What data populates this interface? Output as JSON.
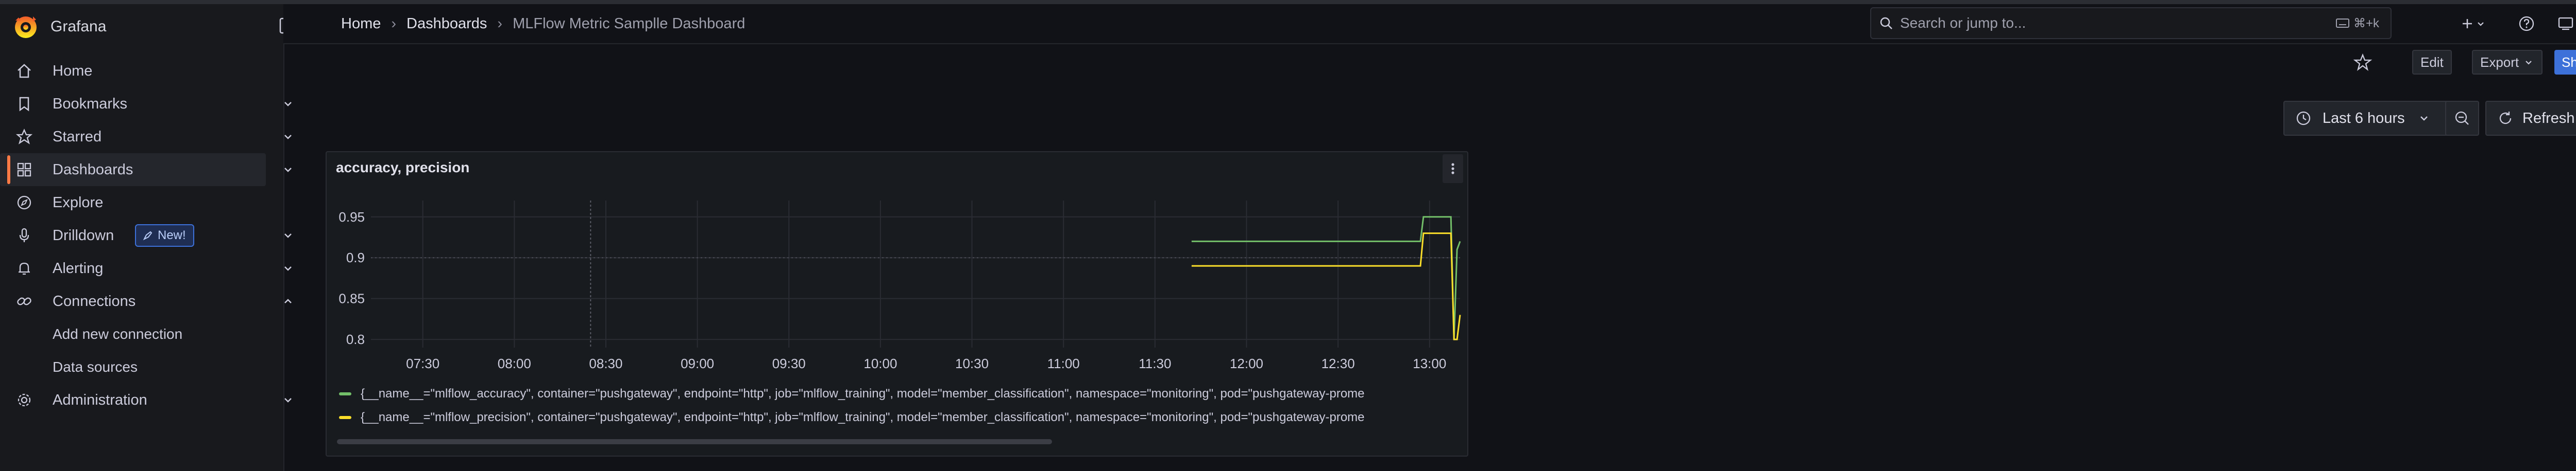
{
  "app": {
    "name": "Grafana"
  },
  "colors": {
    "accent": "#ff7a45",
    "primary": "#3d71d9",
    "series_accuracy": "#73bf69",
    "series_precision": "#fade2a"
  },
  "sidebar": {
    "items": [
      {
        "label": "Home",
        "icon": "home-icon",
        "chevron": ""
      },
      {
        "label": "Bookmarks",
        "icon": "bookmark-icon",
        "chevron": "down"
      },
      {
        "label": "Starred",
        "icon": "star-icon",
        "chevron": "down"
      },
      {
        "label": "Dashboards",
        "icon": "apps-icon",
        "chevron": "down",
        "active": true
      },
      {
        "label": "Explore",
        "icon": "compass-icon",
        "chevron": ""
      },
      {
        "label": "Drilldown",
        "icon": "microphone-icon",
        "chevron": "down",
        "badge": "New!"
      },
      {
        "label": "Alerting",
        "icon": "bell-icon",
        "chevron": "down"
      },
      {
        "label": "Connections",
        "icon": "link-icon",
        "chevron": "up"
      },
      {
        "label": "Administration",
        "icon": "cog-icon",
        "chevron": "down"
      }
    ],
    "connections_sub": [
      "Add new connection",
      "Data sources"
    ]
  },
  "header": {
    "breadcrumbs": [
      "Home",
      "Dashboards",
      "MLFlow Metric Samplle Dashboard"
    ],
    "search_placeholder": "Search or jump to...",
    "search_shortcut": "⌘+k"
  },
  "toolbar": {
    "edit": "Edit",
    "export": "Export",
    "share": "Share"
  },
  "time_controls": {
    "range": "Last 6 hours",
    "refresh": "Refresh"
  },
  "panel": {
    "title": "accuracy, precision",
    "legend": [
      "{__name__=\"mlflow_accuracy\", container=\"pushgateway\", endpoint=\"http\", job=\"mlflow_training\", model=\"member_classification\", namespace=\"monitoring\", pod=\"pushgateway-prome",
      "{__name__=\"mlflow_precision\", container=\"pushgateway\", endpoint=\"http\", job=\"mlflow_training\", model=\"member_classification\", namespace=\"monitoring\", pod=\"pushgateway-prome"
    ]
  },
  "chart_data": {
    "type": "line",
    "title": "accuracy, precision",
    "xlabel": "",
    "ylabel": "",
    "x_ticks": [
      "07:30",
      "08:00",
      "08:30",
      "09:00",
      "09:30",
      "10:00",
      "10:30",
      "11:00",
      "11:30",
      "12:00",
      "12:30",
      "13:00"
    ],
    "y_ticks": [
      0.95,
      0.9,
      0.85,
      0.8
    ],
    "ylim": [
      0.79,
      0.97
    ],
    "xlim": [
      "07:13",
      "13:10"
    ],
    "grid": true,
    "legend_position": "bottom",
    "series": [
      {
        "name": "{__name__=\"mlflow_accuracy\", container=\"pushgateway\", endpoint=\"http\", job=\"mlflow_training\", model=\"member_classification\", namespace=\"monitoring\", pod=\"pushgateway-prome",
        "color": "#73bf69",
        "points": [
          [
            "11:42",
            0.92
          ],
          [
            "12:57",
            0.92
          ],
          [
            "12:58",
            0.95
          ],
          [
            "13:07",
            0.95
          ],
          [
            "13:08",
            0.8
          ],
          [
            "13:09",
            0.91
          ],
          [
            "13:10",
            0.92
          ]
        ]
      },
      {
        "name": "{__name__=\"mlflow_precision\", container=\"pushgateway\", endpoint=\"http\", job=\"mlflow_training\", model=\"member_classification\", namespace=\"monitoring\", pod=\"pushgateway-prome",
        "color": "#fade2a",
        "points": [
          [
            "11:42",
            0.89
          ],
          [
            "12:57",
            0.89
          ],
          [
            "12:58",
            0.93
          ],
          [
            "13:07",
            0.93
          ],
          [
            "13:08",
            0.8
          ],
          [
            "13:09",
            0.8
          ],
          [
            "13:10",
            0.83
          ]
        ]
      }
    ],
    "reference_line_x": "08:25"
  }
}
